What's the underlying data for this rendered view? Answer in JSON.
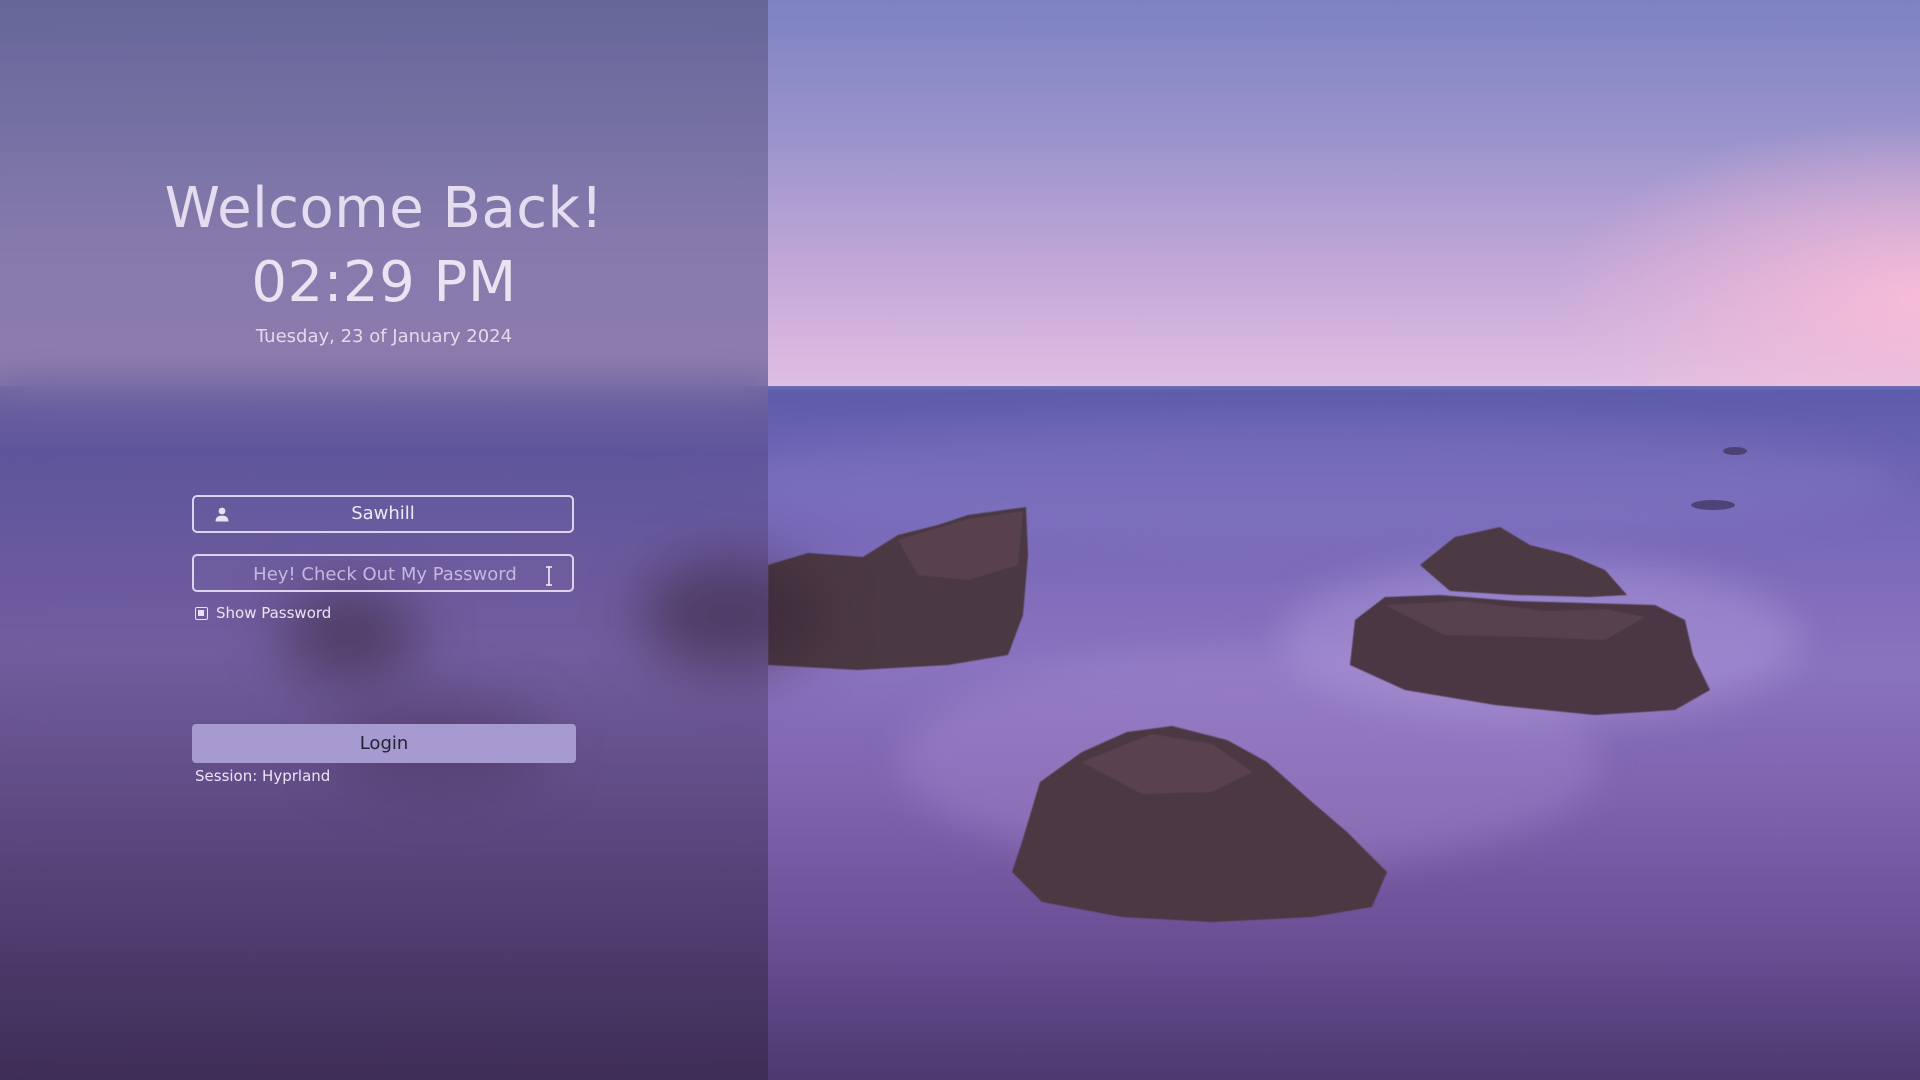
{
  "greeting": "Welcome Back!",
  "clock": {
    "time": "02:29 PM",
    "date": "Tuesday, 23 of January 2024"
  },
  "login_form": {
    "username": "Sawhill",
    "password_placeholder": "Hey! Check Out My Password",
    "show_password_label": "Show Password",
    "show_password_checked": true,
    "login_button_label": "Login",
    "session_label": "Session: Hyprland"
  },
  "icons": {
    "user": "user-icon",
    "text_cursor": "text-cursor-icon",
    "checkbox": "checkbox-icon"
  },
  "colors": {
    "panel_text": "#e6dcef",
    "field_border": "#ddd3ee",
    "login_button_bg": "#a79ad1",
    "login_button_text": "#262033"
  }
}
